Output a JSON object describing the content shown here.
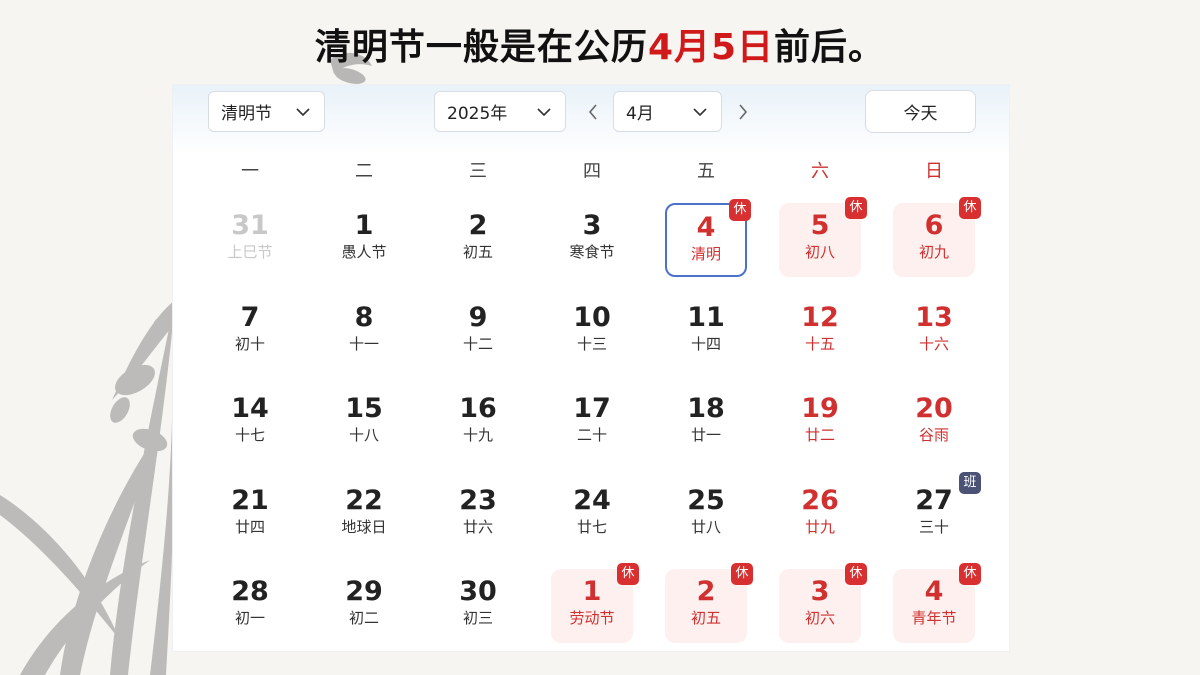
{
  "headline": {
    "prefix": "清明节一般是在公历",
    "highlight": "4月5日",
    "suffix": "前后。"
  },
  "toolbar": {
    "holiday_select": "清明节",
    "year_select": "2025年",
    "month_select": "4月",
    "today_button": "今天"
  },
  "weekdays": [
    "一",
    "二",
    "三",
    "四",
    "五",
    "六",
    "日"
  ],
  "colors": {
    "accent_red": "#d01a1a",
    "holiday_bg": "#fdf0ee",
    "selected_border": "#4a72c8",
    "work_badge": "#4a5276"
  },
  "weeks": [
    [
      {
        "day": "31",
        "label": "上巳节",
        "type": "muted"
      },
      {
        "day": "1",
        "label": "愚人节",
        "type": "normal"
      },
      {
        "day": "2",
        "label": "初五",
        "type": "normal"
      },
      {
        "day": "3",
        "label": "寒食节",
        "type": "normal"
      },
      {
        "day": "4",
        "label": "清明",
        "type": "selected",
        "badge": "休"
      },
      {
        "day": "5",
        "label": "初八",
        "type": "holiday",
        "badge": "休"
      },
      {
        "day": "6",
        "label": "初九",
        "type": "holiday",
        "badge": "休"
      }
    ],
    [
      {
        "day": "7",
        "label": "初十",
        "type": "normal"
      },
      {
        "day": "8",
        "label": "十一",
        "type": "normal"
      },
      {
        "day": "9",
        "label": "十二",
        "type": "normal"
      },
      {
        "day": "10",
        "label": "十三",
        "type": "normal"
      },
      {
        "day": "11",
        "label": "十四",
        "type": "normal"
      },
      {
        "day": "12",
        "label": "十五",
        "type": "weekend"
      },
      {
        "day": "13",
        "label": "十六",
        "type": "weekend"
      }
    ],
    [
      {
        "day": "14",
        "label": "十七",
        "type": "normal"
      },
      {
        "day": "15",
        "label": "十八",
        "type": "normal"
      },
      {
        "day": "16",
        "label": "十九",
        "type": "normal"
      },
      {
        "day": "17",
        "label": "二十",
        "type": "normal"
      },
      {
        "day": "18",
        "label": "廿一",
        "type": "normal"
      },
      {
        "day": "19",
        "label": "廿二",
        "type": "weekend"
      },
      {
        "day": "20",
        "label": "谷雨",
        "type": "weekend"
      }
    ],
    [
      {
        "day": "21",
        "label": "廿四",
        "type": "normal"
      },
      {
        "day": "22",
        "label": "地球日",
        "type": "normal"
      },
      {
        "day": "23",
        "label": "廿六",
        "type": "normal"
      },
      {
        "day": "24",
        "label": "廿七",
        "type": "normal"
      },
      {
        "day": "25",
        "label": "廿八",
        "type": "normal"
      },
      {
        "day": "26",
        "label": "廿九",
        "type": "weekend"
      },
      {
        "day": "27",
        "label": "三十",
        "type": "normal",
        "badge": "班",
        "badge_type": "work"
      }
    ],
    [
      {
        "day": "28",
        "label": "初一",
        "type": "normal"
      },
      {
        "day": "29",
        "label": "初二",
        "type": "normal"
      },
      {
        "day": "30",
        "label": "初三",
        "type": "normal"
      },
      {
        "day": "1",
        "label": "劳动节",
        "type": "holiday",
        "badge": "休"
      },
      {
        "day": "2",
        "label": "初五",
        "type": "holiday",
        "badge": "休"
      },
      {
        "day": "3",
        "label": "初六",
        "type": "holiday",
        "badge": "休"
      },
      {
        "day": "4",
        "label": "青年节",
        "type": "holiday",
        "badge": "休"
      }
    ]
  ]
}
